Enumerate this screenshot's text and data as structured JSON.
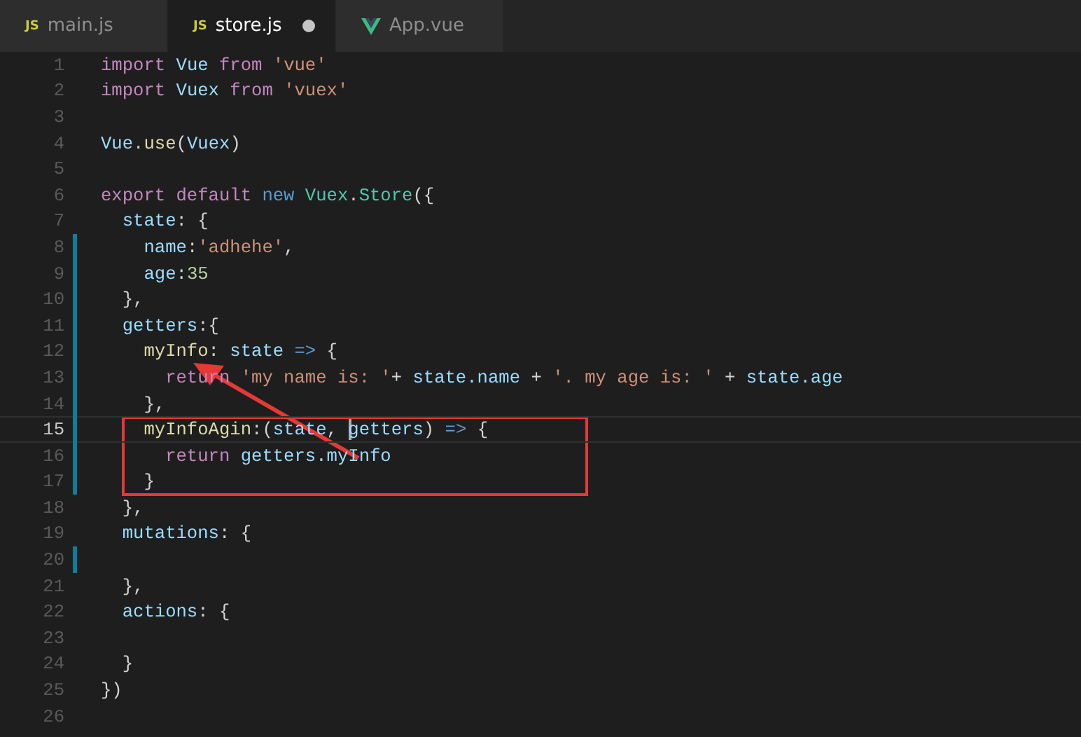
{
  "tabs": [
    {
      "label": "main.js",
      "kind": "js",
      "icon_text": "JS",
      "selected": false,
      "modified": false
    },
    {
      "label": "store.js",
      "kind": "js",
      "icon_text": "JS",
      "selected": true,
      "modified": true
    },
    {
      "label": "App.vue",
      "kind": "vue",
      "selected": false,
      "modified": false
    }
  ],
  "lines": [
    {
      "number": "1",
      "modified": false,
      "current": false,
      "tokens": [
        {
          "t": "import ",
          "kind": "keyword"
        },
        {
          "t": "Vue ",
          "kind": "variable"
        },
        {
          "t": "from ",
          "kind": "keyword"
        },
        {
          "t": "'vue'",
          "kind": "string"
        }
      ]
    },
    {
      "number": "2",
      "modified": false,
      "current": false,
      "tokens": [
        {
          "t": "import ",
          "kind": "keyword"
        },
        {
          "t": "Vuex ",
          "kind": "variable"
        },
        {
          "t": "from ",
          "kind": "keyword"
        },
        {
          "t": "'vuex'",
          "kind": "string"
        }
      ]
    },
    {
      "number": "3",
      "modified": false,
      "current": false
    },
    {
      "number": "4",
      "modified": false,
      "current": false,
      "tokens": [
        {
          "t": "Vue",
          "kind": "variable"
        },
        {
          "t": ".",
          "kind": "plain"
        },
        {
          "t": "use",
          "kind": "function"
        },
        {
          "t": "(",
          "kind": "plain"
        },
        {
          "t": "Vuex",
          "kind": "variable"
        },
        {
          "t": ")",
          "kind": "plain"
        }
      ]
    },
    {
      "number": "5",
      "modified": false,
      "current": false
    },
    {
      "number": "6",
      "modified": false,
      "current": false,
      "tokens": [
        {
          "t": "export default ",
          "kind": "keyword"
        },
        {
          "t": "new ",
          "kind": "storage"
        },
        {
          "t": "Vuex",
          "kind": "class"
        },
        {
          "t": ".",
          "kind": "plain"
        },
        {
          "t": "Store",
          "kind": "class"
        },
        {
          "t": "({",
          "kind": "plain"
        }
      ]
    },
    {
      "number": "7",
      "modified": false,
      "current": false,
      "tokens": [
        {
          "t": "  state",
          "kind": "variable"
        },
        {
          "t": ": {",
          "kind": "plain"
        }
      ]
    },
    {
      "number": "8",
      "modified": true,
      "current": false,
      "tokens": [
        {
          "t": "    name",
          "kind": "variable"
        },
        {
          "t": ":",
          "kind": "plain"
        },
        {
          "t": "'adhehe'",
          "kind": "string"
        },
        {
          "t": ",",
          "kind": "plain"
        }
      ]
    },
    {
      "number": "9",
      "modified": true,
      "current": false,
      "tokens": [
        {
          "t": "    age",
          "kind": "variable"
        },
        {
          "t": ":",
          "kind": "plain"
        },
        {
          "t": "35",
          "kind": "number"
        }
      ]
    },
    {
      "number": "10",
      "modified": true,
      "current": false,
      "tokens": [
        {
          "t": "  },",
          "kind": "plain"
        }
      ]
    },
    {
      "number": "11",
      "modified": true,
      "current": false,
      "tokens": [
        {
          "t": "  getters",
          "kind": "variable"
        },
        {
          "t": ":{",
          "kind": "plain"
        }
      ]
    },
    {
      "number": "12",
      "modified": true,
      "current": false,
      "tokens": [
        {
          "t": "    myInfo",
          "kind": "function"
        },
        {
          "t": ": ",
          "kind": "plain"
        },
        {
          "t": "state ",
          "kind": "variable"
        },
        {
          "t": "=> ",
          "kind": "storage"
        },
        {
          "t": "{",
          "kind": "plain"
        }
      ]
    },
    {
      "number": "13",
      "modified": true,
      "current": false,
      "tokens": [
        {
          "t": "      return ",
          "kind": "keyword"
        },
        {
          "t": "'my name is: '",
          "kind": "string"
        },
        {
          "t": "+ ",
          "kind": "plain"
        },
        {
          "t": "state.name",
          "kind": "variable"
        },
        {
          "t": " + ",
          "kind": "plain"
        },
        {
          "t": "'. my age is: '",
          "kind": "string"
        },
        {
          "t": " + ",
          "kind": "plain"
        },
        {
          "t": "state.age",
          "kind": "variable"
        }
      ]
    },
    {
      "number": "14",
      "modified": true,
      "current": false,
      "tokens": [
        {
          "t": "    },",
          "kind": "plain"
        }
      ]
    },
    {
      "number": "15",
      "modified": true,
      "current": true,
      "tokens": [
        {
          "t": "    myInfoAgin",
          "kind": "function"
        },
        {
          "t": ":(",
          "kind": "plain"
        },
        {
          "t": "state",
          "kind": "variable"
        },
        {
          "t": ", ",
          "kind": "plain"
        },
        {
          "t": "getters",
          "kind": "variable",
          "cursor": true
        },
        {
          "t": ") ",
          "kind": "plain"
        },
        {
          "t": "=> ",
          "kind": "storage"
        },
        {
          "t": "{",
          "kind": "plain"
        }
      ]
    },
    {
      "number": "16",
      "modified": true,
      "current": false,
      "tokens": [
        {
          "t": "      return ",
          "kind": "keyword"
        },
        {
          "t": "getters.myInfo",
          "kind": "variable"
        }
      ]
    },
    {
      "number": "17",
      "modified": true,
      "current": false,
      "tokens": [
        {
          "t": "    }",
          "kind": "plain"
        }
      ]
    },
    {
      "number": "18",
      "modified": false,
      "current": false,
      "tokens": [
        {
          "t": "  },",
          "kind": "plain"
        }
      ]
    },
    {
      "number": "19",
      "modified": false,
      "current": false,
      "tokens": [
        {
          "t": "  mutations",
          "kind": "variable"
        },
        {
          "t": ": {",
          "kind": "plain"
        }
      ]
    },
    {
      "number": "20",
      "modified": true,
      "current": false
    },
    {
      "number": "21",
      "modified": false,
      "current": false,
      "tokens": [
        {
          "t": "  },",
          "kind": "plain"
        }
      ]
    },
    {
      "number": "22",
      "modified": false,
      "current": false,
      "tokens": [
        {
          "t": "  actions",
          "kind": "variable"
        },
        {
          "t": ": {",
          "kind": "plain"
        }
      ]
    },
    {
      "number": "23",
      "modified": false,
      "current": false
    },
    {
      "number": "24",
      "modified": false,
      "current": false,
      "tokens": [
        {
          "t": "  }",
          "kind": "plain"
        }
      ]
    },
    {
      "number": "25",
      "modified": false,
      "current": false,
      "tokens": [
        {
          "t": "})",
          "kind": "plain"
        }
      ]
    },
    {
      "number": "26",
      "modified": false,
      "current": false
    }
  ]
}
